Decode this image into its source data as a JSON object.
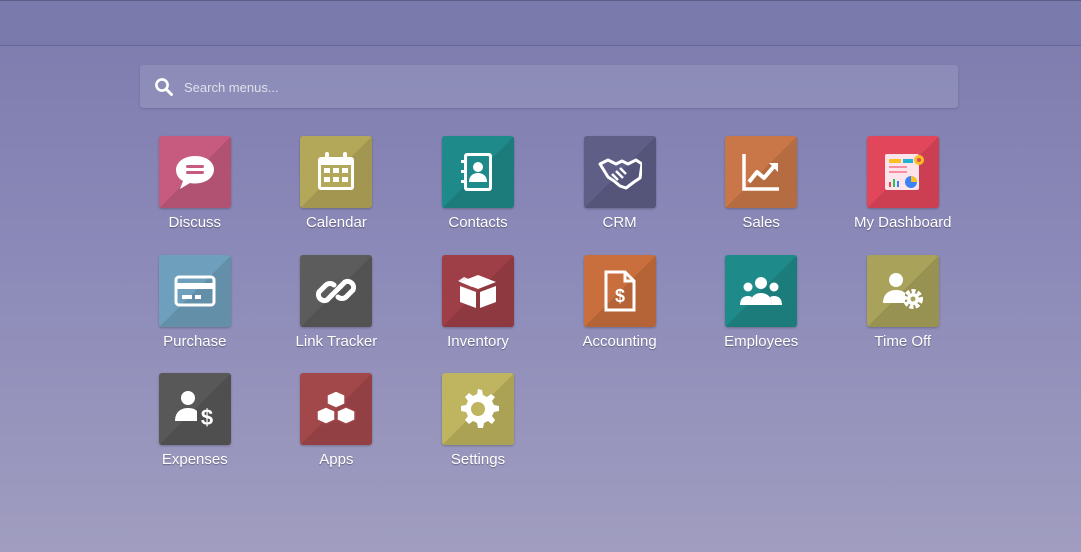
{
  "search": {
    "placeholder": "Search menus..."
  },
  "apps": [
    {
      "label": "Discuss",
      "icon": "chat-bubble-icon",
      "color": "#c65b7f"
    },
    {
      "label": "Calendar",
      "icon": "calendar-icon",
      "color": "#b3a75a"
    },
    {
      "label": "Contacts",
      "icon": "address-book-icon",
      "color": "#1f8a8a"
    },
    {
      "label": "CRM",
      "icon": "handshake-icon",
      "color": "#5e5e87"
    },
    {
      "label": "Sales",
      "icon": "chart-trend-icon",
      "color": "#c97748"
    },
    {
      "label": "My Dashboard",
      "icon": "dashboard-icon",
      "color": "#e2465b"
    },
    {
      "label": "Purchase",
      "icon": "credit-card-icon",
      "color": "#6e9fbc"
    },
    {
      "label": "Link Tracker",
      "icon": "link-icon",
      "color": "#5c5c5c"
    },
    {
      "label": "Inventory",
      "icon": "box-icon",
      "color": "#9e3f47"
    },
    {
      "label": "Accounting",
      "icon": "invoice-dollar-icon",
      "color": "#c96f3d"
    },
    {
      "label": "Employees",
      "icon": "users-icon",
      "color": "#1f8a8a"
    },
    {
      "label": "Time Off",
      "icon": "user-gear-icon",
      "color": "#a8a25b"
    },
    {
      "label": "Expenses",
      "icon": "user-dollar-icon",
      "color": "#585858"
    },
    {
      "label": "Apps",
      "icon": "cubes-icon",
      "color": "#a2474a"
    },
    {
      "label": "Settings",
      "icon": "gear-icon",
      "color": "#bfb45f"
    }
  ]
}
